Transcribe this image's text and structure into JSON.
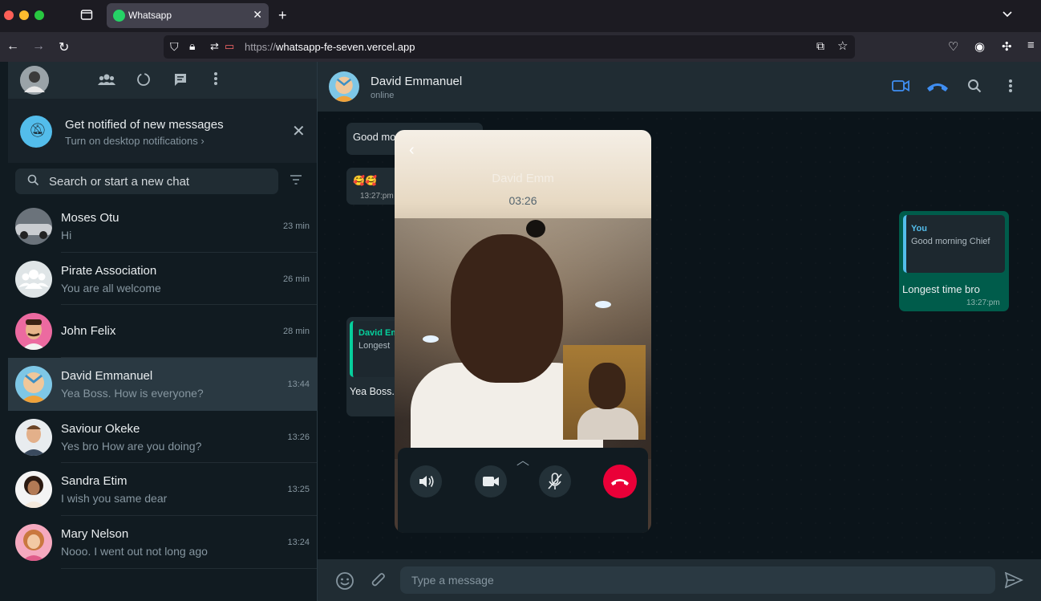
{
  "browser": {
    "tab_title": "Whatsapp",
    "url_scheme": "https://",
    "url_host": "whatsapp-fe-seven.vercel.app"
  },
  "sidebar": {
    "notification": {
      "title": "Get notified of new messages",
      "subtitle": "Turn on desktop notifications ›"
    },
    "search_placeholder": "Search or start a new chat",
    "chats": [
      {
        "name": "Moses Otu",
        "preview": "Hi",
        "time": "23 min"
      },
      {
        "name": "Pirate Association",
        "preview": "You are all welcome",
        "time": "26 min"
      },
      {
        "name": "John Felix",
        "preview": "",
        "time": "28 min"
      },
      {
        "name": "David Emmanuel",
        "preview": "Yea Boss. How is everyone?",
        "time": "13:44"
      },
      {
        "name": "Saviour Okeke",
        "preview": "Yes bro How are you doing?",
        "time": "13:26"
      },
      {
        "name": "Sandra Etim",
        "preview": "I wish you same dear",
        "time": "13:25"
      },
      {
        "name": "Mary Nelson",
        "preview": "Nooo. I went out not long ago",
        "time": "13:24"
      }
    ]
  },
  "conversation": {
    "name": "David Emmanuel",
    "status": "online",
    "messages": {
      "in1_text": "Good mo",
      "in2_text": "🥰🥰",
      "in2_time": "13:27:pm",
      "in3_quote_author": "David Em",
      "in3_quote_text": "Longest",
      "in3_text": "Yea Boss.",
      "out_quote_author": "You",
      "out_quote_text": "Good morning Chief",
      "out_text": "Longest time bro",
      "out_time": "13:27:pm"
    },
    "composer_placeholder": "Type a message"
  },
  "call": {
    "name": "David Emm",
    "timer": "03:26"
  },
  "colors": {
    "accent_blue": "#53bdeb",
    "hangup_red": "#ea0038",
    "outgoing_bubble": "#005c4b",
    "online_green": "#25d366"
  }
}
